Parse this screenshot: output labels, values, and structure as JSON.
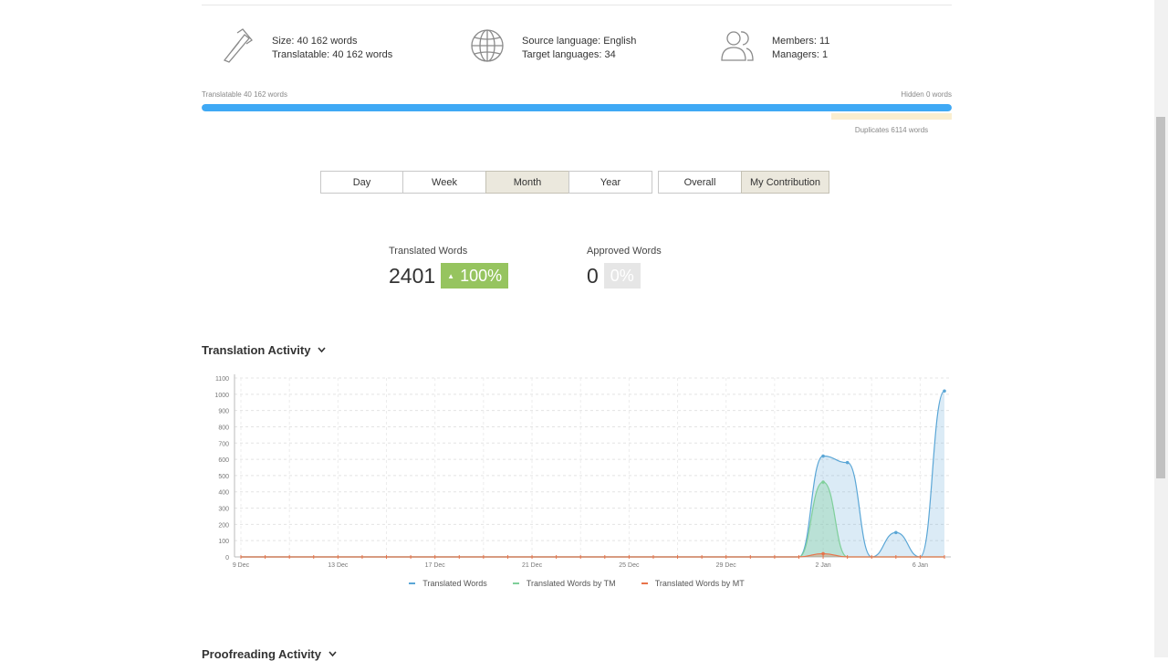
{
  "stats": {
    "size": "Size: 40 162 words",
    "translatable": "Translatable: 40 162 words",
    "source_language": "Source language: English",
    "target_languages": "Target languages: 34",
    "members": "Members: 11",
    "managers": "Managers: 1"
  },
  "progress": {
    "translatable_label": "Translatable 40 162 words",
    "hidden_label": "Hidden 0 words",
    "duplicates_label": "Duplicates 6114 words",
    "translatable_fraction": 1.0,
    "duplicates_fraction": 0.16
  },
  "period_tabs": [
    {
      "label": "Day",
      "active": false
    },
    {
      "label": "Week",
      "active": false
    },
    {
      "label": "Month",
      "active": true
    },
    {
      "label": "Year",
      "active": false
    }
  ],
  "scope_tabs": [
    {
      "label": "Overall",
      "active": false
    },
    {
      "label": "My Contribution",
      "active": true
    }
  ],
  "metrics": {
    "translated": {
      "label": "Translated Words",
      "value": "2401",
      "change": "100%"
    },
    "approved": {
      "label": "Approved Words",
      "value": "0",
      "change": "0%"
    }
  },
  "sections": {
    "translation_activity": "Translation Activity",
    "proofreading_activity": "Proofreading Activity"
  },
  "colors": {
    "accent": "#3fa9f5",
    "translated": "#5aa6d6",
    "tm": "#7fcf9a",
    "mt": "#e8734a"
  },
  "chart_data": {
    "type": "area",
    "ylim": [
      0,
      1100
    ],
    "yticks": [
      0,
      100,
      200,
      300,
      400,
      500,
      600,
      700,
      800,
      900,
      1000,
      1100
    ],
    "xlim": [
      "9 Dec",
      "7 Jan"
    ],
    "x_tick_labels": [
      "9 Dec",
      "13 Dec",
      "17 Dec",
      "21 Dec",
      "25 Dec",
      "29 Dec",
      "2 Jan",
      "6 Jan"
    ],
    "x": [
      "9 Dec",
      "10 Dec",
      "11 Dec",
      "12 Dec",
      "13 Dec",
      "14 Dec",
      "15 Dec",
      "16 Dec",
      "17 Dec",
      "18 Dec",
      "19 Dec",
      "20 Dec",
      "21 Dec",
      "22 Dec",
      "23 Dec",
      "24 Dec",
      "25 Dec",
      "26 Dec",
      "27 Dec",
      "28 Dec",
      "29 Dec",
      "30 Dec",
      "31 Dec",
      "1 Jan",
      "2 Jan",
      "3 Jan",
      "4 Jan",
      "5 Jan",
      "6 Jan",
      "7 Jan"
    ],
    "series": [
      {
        "name": "Translated Words",
        "values": [
          0,
          0,
          0,
          0,
          0,
          0,
          0,
          0,
          0,
          0,
          0,
          0,
          0,
          0,
          0,
          0,
          0,
          0,
          0,
          0,
          0,
          0,
          0,
          0,
          620,
          580,
          0,
          150,
          0,
          1020
        ]
      },
      {
        "name": "Translated Words by TM",
        "values": [
          0,
          0,
          0,
          0,
          0,
          0,
          0,
          0,
          0,
          0,
          0,
          0,
          0,
          0,
          0,
          0,
          0,
          0,
          0,
          0,
          0,
          0,
          0,
          0,
          460,
          0,
          0,
          0,
          0,
          0
        ]
      },
      {
        "name": "Translated Words by MT",
        "values": [
          0,
          0,
          0,
          0,
          0,
          0,
          0,
          0,
          0,
          0,
          0,
          0,
          0,
          0,
          0,
          0,
          0,
          0,
          0,
          0,
          0,
          0,
          0,
          0,
          20,
          0,
          0,
          0,
          0,
          0
        ]
      }
    ]
  }
}
